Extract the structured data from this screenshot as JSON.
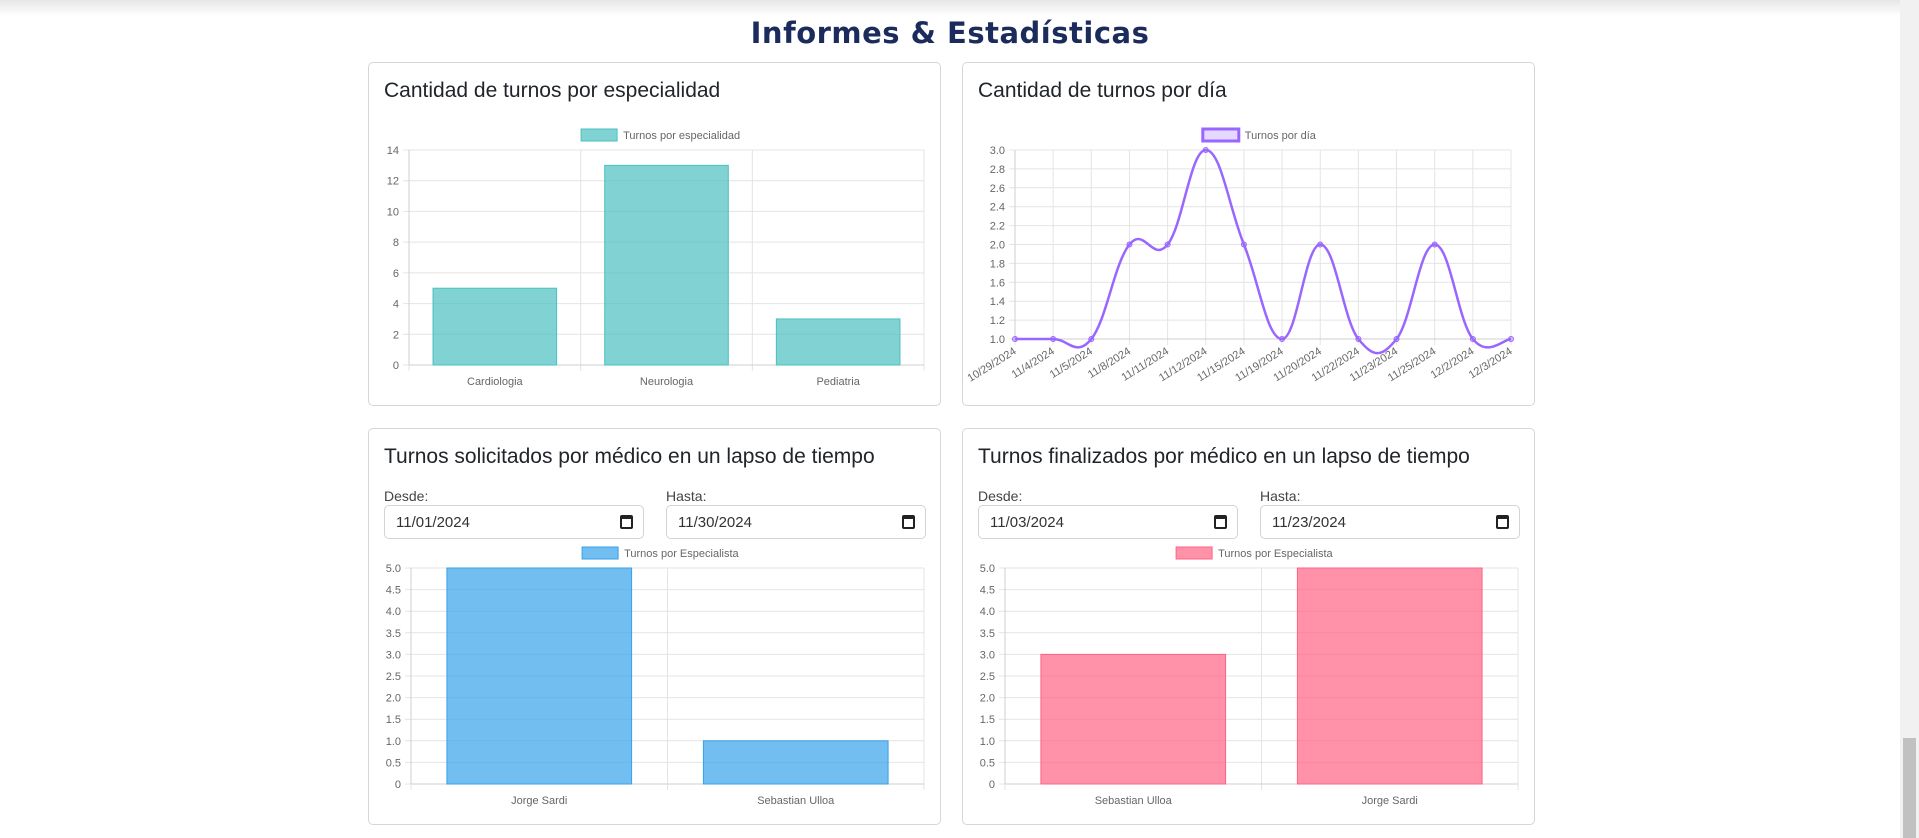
{
  "page": {
    "title": "Informes & Estadísticas"
  },
  "cards": {
    "c1": {
      "title": "Cantidad de turnos por especialidad"
    },
    "c2": {
      "title": "Cantidad de turnos por día"
    },
    "c3": {
      "title": "Turnos solicitados por médico en un lapso de tiempo",
      "desde_label": "Desde:",
      "hasta_label": "Hasta:",
      "desde_value": "11/01/2024",
      "hasta_value": "11/30/2024"
    },
    "c4": {
      "title": "Turnos finalizados por médico en un lapso de tiempo",
      "desde_label": "Desde:",
      "hasta_label": "Hasta:",
      "desde_value": "11/03/2024",
      "hasta_value": "11/23/2024"
    }
  },
  "chart_data": [
    {
      "type": "bar",
      "categories": [
        "Cardiologia",
        "Neurologia",
        "Pediatria"
      ],
      "series": [
        {
          "name": "Turnos por especialidad",
          "values": [
            5,
            13,
            3
          ]
        }
      ],
      "ylim": [
        0,
        14
      ],
      "yticks": [
        0,
        2,
        4,
        6,
        8,
        10,
        12,
        14
      ],
      "grid": true,
      "legend": "top",
      "color": "#4bc0c0"
    },
    {
      "type": "line",
      "categories": [
        "10/29/2024",
        "11/4/2024",
        "11/5/2024",
        "11/8/2024",
        "11/11/2024",
        "11/12/2024",
        "11/15/2024",
        "11/19/2024",
        "11/20/2024",
        "11/22/2024",
        "11/23/2024",
        "11/25/2024",
        "12/2/2024",
        "12/3/2024"
      ],
      "series": [
        {
          "name": "Turnos por día",
          "values": [
            1,
            1,
            1,
            2,
            2,
            3,
            2,
            1,
            2,
            1,
            1,
            2,
            1,
            1
          ]
        }
      ],
      "ylim": [
        1,
        3
      ],
      "yticks": [
        "1.0",
        "1.2",
        "1.4",
        "1.6",
        "1.8",
        "2.0",
        "2.2",
        "2.4",
        "2.6",
        "2.8",
        "3.0"
      ],
      "grid": true,
      "legend": "top",
      "color": "#9966ff"
    },
    {
      "type": "bar",
      "categories": [
        "Jorge Sardi",
        "Sebastian Ulloa"
      ],
      "series": [
        {
          "name": "Turnos por Especialista",
          "values": [
            5,
            1
          ]
        }
      ],
      "ylim": [
        0,
        5
      ],
      "yticks": [
        "0",
        "0.5",
        "1.0",
        "1.5",
        "2.0",
        "2.5",
        "3.0",
        "3.5",
        "4.0",
        "4.5",
        "5.0"
      ],
      "grid": true,
      "legend": "top",
      "color": "#36a2eb"
    },
    {
      "type": "bar",
      "categories": [
        "Sebastian Ulloa",
        "Jorge Sardi"
      ],
      "series": [
        {
          "name": "Turnos por Especialista",
          "values": [
            3,
            5
          ]
        }
      ],
      "ylim": [
        0,
        5
      ],
      "yticks": [
        "0",
        "0.5",
        "1.0",
        "1.5",
        "2.0",
        "2.5",
        "3.0",
        "3.5",
        "4.0",
        "4.5",
        "5.0"
      ],
      "grid": true,
      "legend": "top",
      "color": "#ff6384"
    }
  ]
}
